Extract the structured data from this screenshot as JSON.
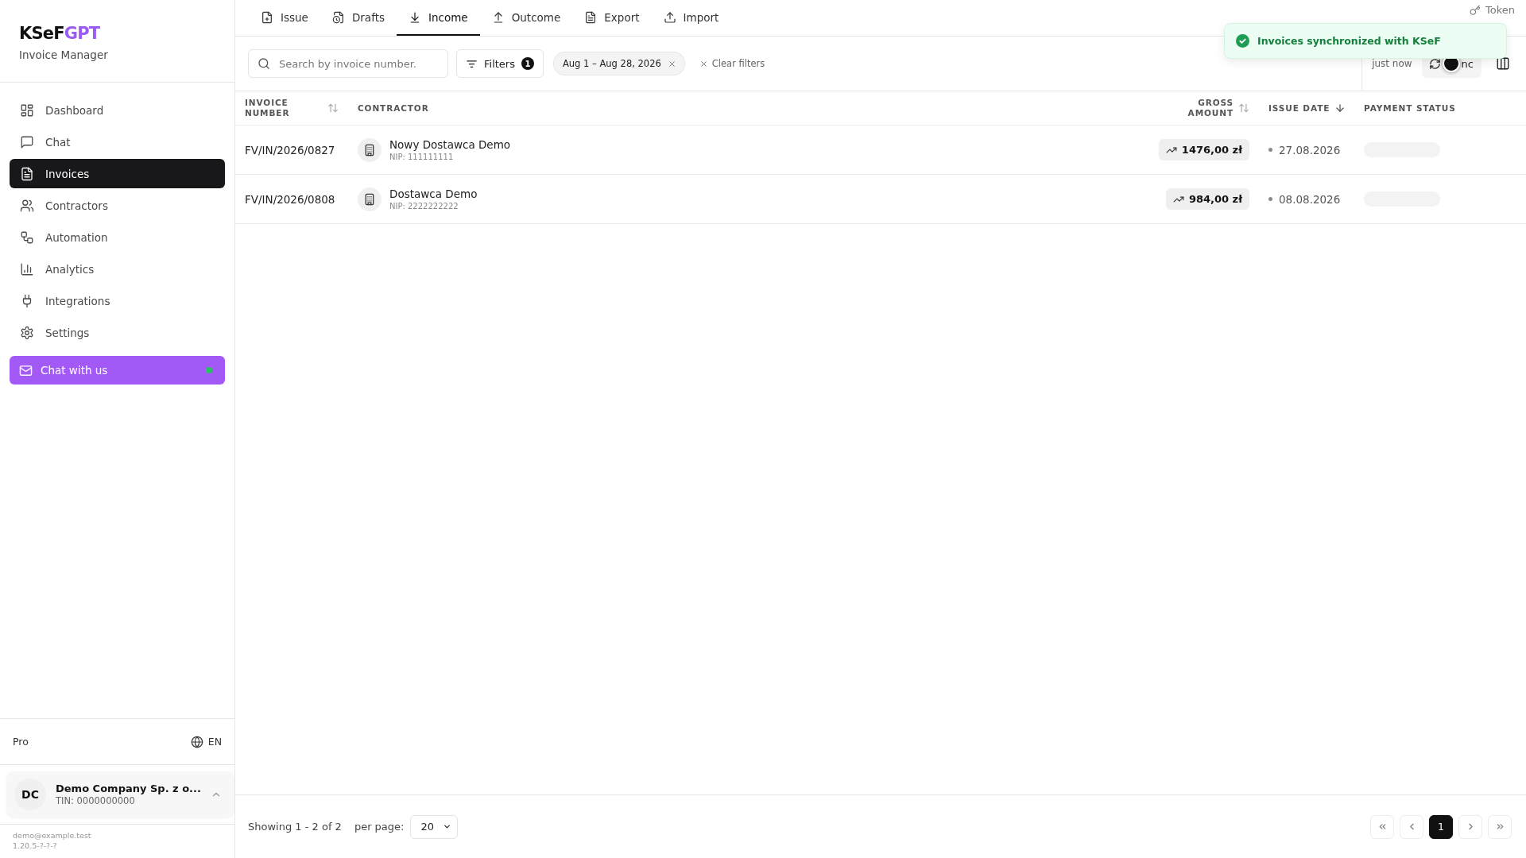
{
  "sidebar": {
    "logo": {
      "prefix": "KSeF",
      "suffix": "GPT"
    },
    "subtitle": "Invoice Manager",
    "nav": [
      {
        "label": "Dashboard",
        "selected": false
      },
      {
        "label": "Chat",
        "selected": false
      },
      {
        "label": "Invoices",
        "selected": true
      },
      {
        "label": "Contractors",
        "selected": false
      },
      {
        "label": "Automation",
        "selected": false
      },
      {
        "label": "Analytics",
        "selected": false
      },
      {
        "label": "Integrations",
        "selected": false
      },
      {
        "label": "Settings",
        "selected": false
      }
    ],
    "chat_button": {
      "label": "Chat with us",
      "online": true
    },
    "plan": "Pro",
    "language": "EN",
    "company": {
      "initials": "DC",
      "name": "Demo Company Sp. z o...",
      "tin": "TIN: 0000000000"
    },
    "email": "demo@example.test",
    "version": "1.20.5-?-?-?"
  },
  "tabs": [
    {
      "label": "Issue",
      "selected": false
    },
    {
      "label": "Drafts",
      "selected": false
    },
    {
      "label": "Income",
      "selected": true
    },
    {
      "label": "Outcome",
      "selected": false
    },
    {
      "label": "Export",
      "selected": false
    },
    {
      "label": "Import",
      "selected": false
    }
  ],
  "token": {
    "label": "Token"
  },
  "toast": {
    "kind": "success",
    "message": "Invoices synchronized with KSeF"
  },
  "toolbar": {
    "search": {
      "placeholder": "Search by invoice number."
    },
    "filters": {
      "label": "Filters",
      "count": "1"
    },
    "chips": [
      {
        "label": "Aug 1 – Aug 28, 2026"
      }
    ],
    "clear_filters": "Clear filters",
    "last_sync": "just now",
    "sync_button": {
      "label": "nc"
    }
  },
  "table": {
    "columns": [
      {
        "label": "INVOICE NUMBER",
        "sortable": true,
        "sorted_descending": false
      },
      {
        "label": "CONTRACTOR"
      },
      {
        "label": "GROSS AMOUNT",
        "sortable": true,
        "sorted_descending": false
      },
      {
        "label": "ISSUE DATE",
        "sortable": true,
        "sorted_descending": true
      },
      {
        "label": "PAYMENT STATUS"
      }
    ],
    "rows": [
      {
        "invoice_number": "FV/IN/2026/0827",
        "contractor": "Nowy Dostawca Demo",
        "nip": "NIP: 111111111",
        "gross_amount": "1476,00 zł",
        "trend_up": true,
        "issue_date": "27.08.2026",
        "payment_status_loading": true
      },
      {
        "invoice_number": "FV/IN/2026/0808",
        "contractor": "Dostawca Demo",
        "nip": "NIP: 2222222222",
        "gross_amount": "984,00 zł",
        "trend_up": true,
        "issue_date": "08.08.2026",
        "payment_status_loading": true
      }
    ]
  },
  "footer": {
    "summary": "Showing 1 - 2 of 2",
    "per_page_label": "per page:",
    "per_page": "20",
    "pages": [
      {
        "label": "1",
        "selected": true
      }
    ]
  }
}
